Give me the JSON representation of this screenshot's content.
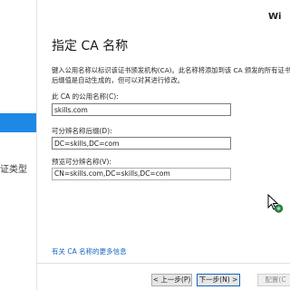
{
  "window": {
    "brand": "Wi"
  },
  "sidebar": {
    "item_partial_label": "证类型"
  },
  "page": {
    "title": "指定 CA 名称",
    "description_line1": "键入公用名称以标识该证书颁发机构(CA)。此名称将添加到该 CA 颁发的所有证书",
    "description_line2": "后缀值是自动生成的，但可以对其进行修改。"
  },
  "fields": {
    "common_name": {
      "label": "此 CA 的公用名称(C):",
      "value": "skills.com"
    },
    "dn_suffix": {
      "label": "可分辨名称后缀(D):",
      "value": "DC=skills,DC=com"
    },
    "preview_dn": {
      "label": "预览可分辨名称(V):",
      "value": "CN=skills.com,DC=skills,DC=com"
    }
  },
  "links": {
    "more_about_ca_name": "有关 CA 名称的更多信息"
  },
  "buttons": {
    "prev": "< 上一步(P)",
    "next": "下一步(N) >",
    "configure": "配置(C"
  },
  "colors": {
    "accent": "#1e88e5",
    "link": "#1565c0"
  }
}
